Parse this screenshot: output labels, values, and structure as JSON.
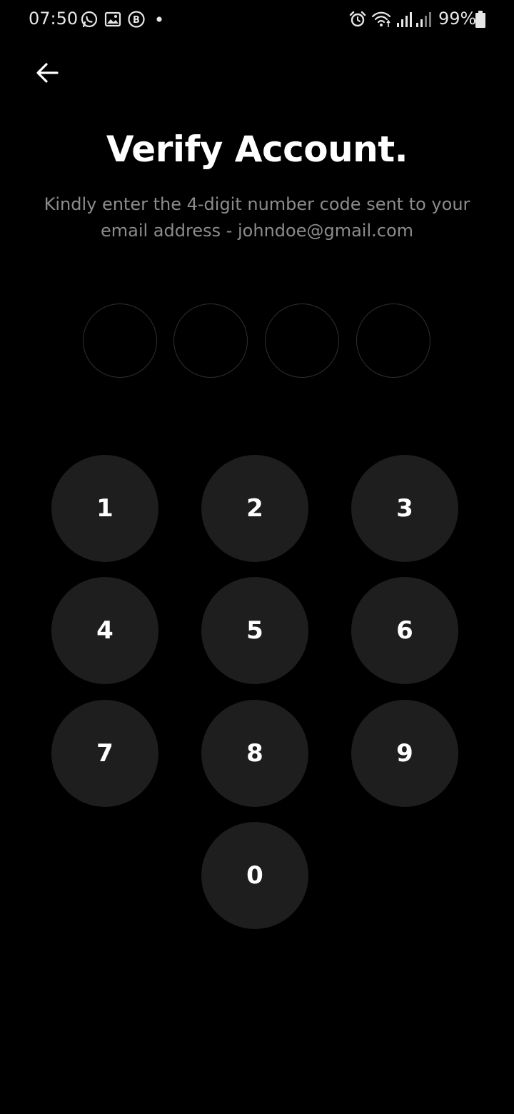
{
  "status_bar": {
    "time": "07:50",
    "battery_text": "99%",
    "left_icons": [
      "whatsapp-icon",
      "gallery-icon",
      "b-app-icon",
      "dot-icon"
    ],
    "right_icons": [
      "alarm-icon",
      "wifi-icon",
      "signal-icon",
      "signal-icon",
      "battery-icon"
    ]
  },
  "header": {
    "title": "Verify Account.",
    "subtitle": "Kindly enter the 4-digit number code sent to your email address - johndoe@gmail.com"
  },
  "otp": {
    "values": [
      "",
      "",
      "",
      ""
    ]
  },
  "keypad": {
    "keys": [
      "1",
      "2",
      "3",
      "4",
      "5",
      "6",
      "7",
      "8",
      "9",
      "0"
    ]
  },
  "colors": {
    "background": "#000000",
    "key_background": "#1e1e1e",
    "otp_border": "#2f2f2f",
    "subtitle": "#8c8c8c",
    "text": "#ffffff"
  }
}
